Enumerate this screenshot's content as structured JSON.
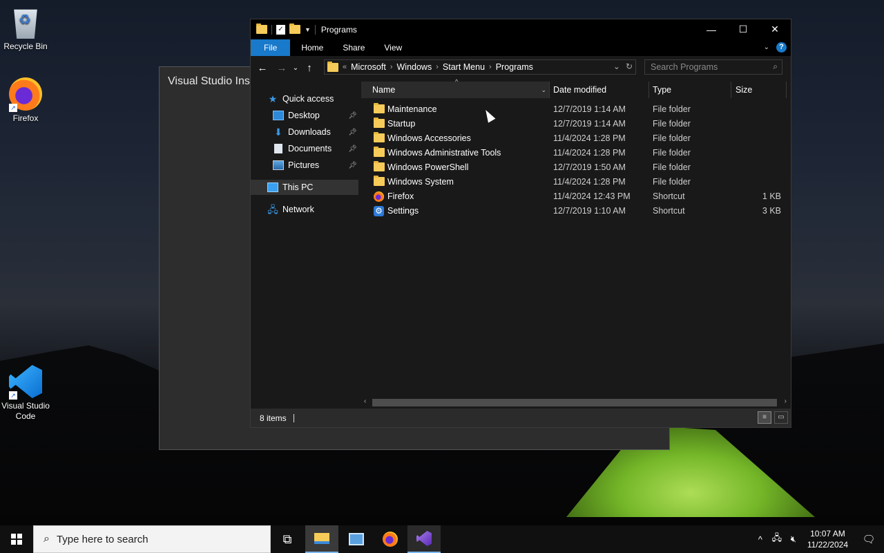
{
  "desktop": {
    "icons": [
      {
        "label": "Recycle Bin",
        "icon": "recycle-bin-icon"
      },
      {
        "label": "Firefox",
        "icon": "firefox-icon"
      },
      {
        "label": "Visual Studio Code",
        "icon": "vscode-icon"
      }
    ]
  },
  "background_window": {
    "title": "Visual Studio Inst"
  },
  "explorer": {
    "title": "Programs",
    "controls": {
      "minimize": "—",
      "maximize": "☐",
      "close": "✕"
    },
    "ribbon": {
      "tabs": [
        "File",
        "Home",
        "Share",
        "View"
      ]
    },
    "address": {
      "overflow": "«",
      "crumbs": [
        "Microsoft",
        "Windows",
        "Start Menu",
        "Programs"
      ],
      "separator": "›"
    },
    "search": {
      "placeholder": "Search Programs"
    },
    "nav": {
      "quick_access": "Quick access",
      "pinned": [
        "Desktop",
        "Downloads",
        "Documents",
        "Pictures"
      ],
      "this_pc": "This PC",
      "network": "Network"
    },
    "columns": {
      "name": "Name",
      "date": "Date modified",
      "type": "Type",
      "size": "Size"
    },
    "rows": [
      {
        "name": "Maintenance",
        "date": "12/7/2019 1:14 AM",
        "type": "File folder",
        "size": "",
        "icon": "folder-icon"
      },
      {
        "name": "Startup",
        "date": "12/7/2019 1:14 AM",
        "type": "File folder",
        "size": "",
        "icon": "folder-icon"
      },
      {
        "name": "Windows Accessories",
        "date": "11/4/2024 1:28 PM",
        "type": "File folder",
        "size": "",
        "icon": "folder-icon"
      },
      {
        "name": "Windows Administrative Tools",
        "date": "11/4/2024 1:28 PM",
        "type": "File folder",
        "size": "",
        "icon": "folder-icon"
      },
      {
        "name": "Windows PowerShell",
        "date": "12/7/2019 1:50 AM",
        "type": "File folder",
        "size": "",
        "icon": "folder-icon"
      },
      {
        "name": "Windows System",
        "date": "11/4/2024 1:28 PM",
        "type": "File folder",
        "size": "",
        "icon": "folder-icon"
      },
      {
        "name": "Firefox",
        "date": "11/4/2024 12:43 PM",
        "type": "Shortcut",
        "size": "1 KB",
        "icon": "firefox-icon"
      },
      {
        "name": "Settings",
        "date": "12/7/2019 1:10 AM",
        "type": "Shortcut",
        "size": "3 KB",
        "icon": "gear-icon"
      }
    ],
    "status": {
      "item_count": "8 items"
    }
  },
  "taskbar": {
    "search_placeholder": "Type here to search",
    "apps": [
      "task-view-icon",
      "file-explorer-icon",
      "control-panel-icon",
      "firefox-icon",
      "visual-studio-installer-icon"
    ],
    "clock": {
      "time": "10:07 AM",
      "date": "11/22/2024"
    }
  }
}
